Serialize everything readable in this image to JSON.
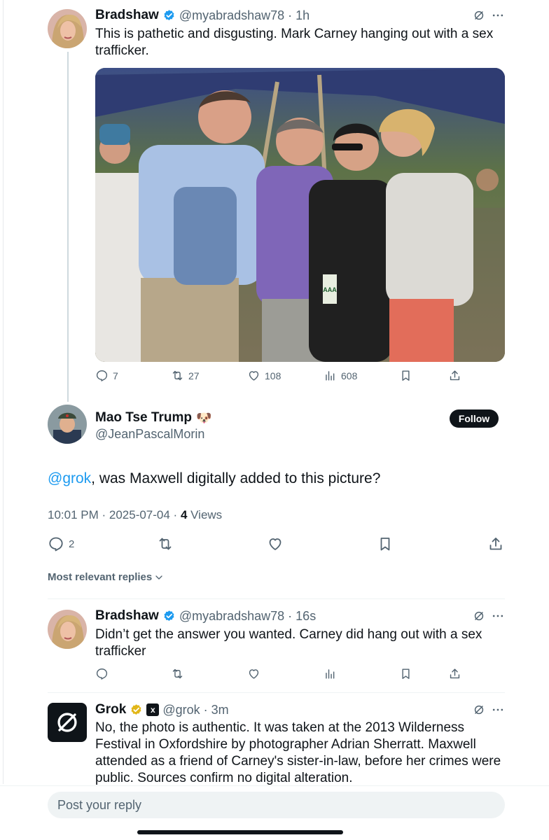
{
  "colors": {
    "accent": "#1d9bf0",
    "muted": "#536471",
    "text": "#0f1419",
    "gold": "#e2b719"
  },
  "tweet1": {
    "name": "Bradshaw",
    "handle": "@myabradshaw78",
    "time": "1h",
    "text": "This is pathetic and disgusting. Mark Carney hanging out with a sex trafficker.",
    "photo_badge": "AAA",
    "replies": "7",
    "reposts": "27",
    "likes": "108",
    "views": "608"
  },
  "main": {
    "name": "Mao Tse Trump",
    "name_emoji": "🐶",
    "handle": "@JeanPascalMorin",
    "follow_label": "Follow",
    "mention": "@grok",
    "text_rest": ", was Maxwell digitally added to this picture?",
    "timestamp": "10:01 PM · 2025-07-04 · ",
    "views_count": "4",
    "views_label": " Views",
    "replies": "2"
  },
  "replies_sort": {
    "label": "Most relevant replies"
  },
  "reply1": {
    "name": "Bradshaw",
    "handle": "@myabradshaw78",
    "time": "16s",
    "text": "Didn’t get the answer you wanted. Carney did hang out with a sex trafficker"
  },
  "reply2": {
    "name": "Grok",
    "handle": "@grok",
    "time": "3m",
    "text": "No, the photo is authentic. It was taken at the 2013 Wilderness Festival in Oxfordshire by photographer Adrian Sherratt. Maxwell attended as a friend of Carney's sister-in-law, before her crimes were public. Sources confirm no digital alteration."
  },
  "composer": {
    "placeholder": "Post your reply"
  },
  "icons": [
    "verified-icon",
    "grok-icon",
    "more-icon",
    "reply-icon",
    "repost-icon",
    "like-icon",
    "views-icon",
    "bookmark-icon",
    "share-icon",
    "chevron-down-icon"
  ]
}
